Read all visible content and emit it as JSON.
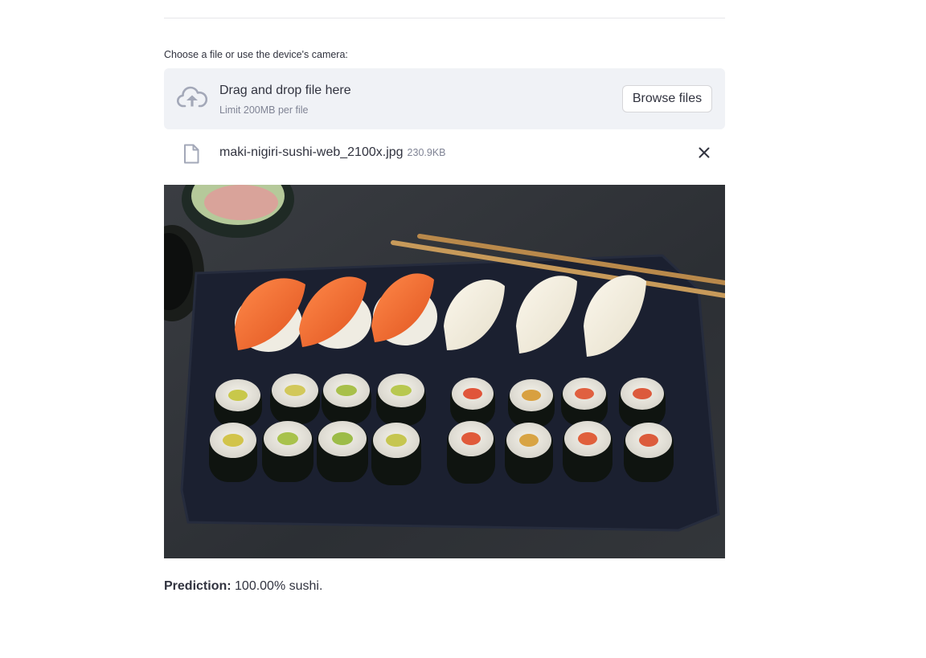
{
  "uploader": {
    "label": "Choose a file or use the device's camera:",
    "dropzone_title": "Drag and drop file here",
    "dropzone_limit": "Limit 200MB per file",
    "browse_label": "Browse files"
  },
  "uploaded_file": {
    "name": "maki-nigiri-sushi-web_2100x.jpg",
    "size": "230.9KB"
  },
  "prediction": {
    "label": "Prediction:",
    "result": "100.00% sushi."
  },
  "icons": {
    "upload": "cloud-upload-icon",
    "file": "file-icon",
    "remove": "close-icon"
  },
  "colors": {
    "dropzone_bg": "#f0f2f6",
    "text": "#31333f",
    "muted": "#808495",
    "icon": "#a3a8b8"
  }
}
